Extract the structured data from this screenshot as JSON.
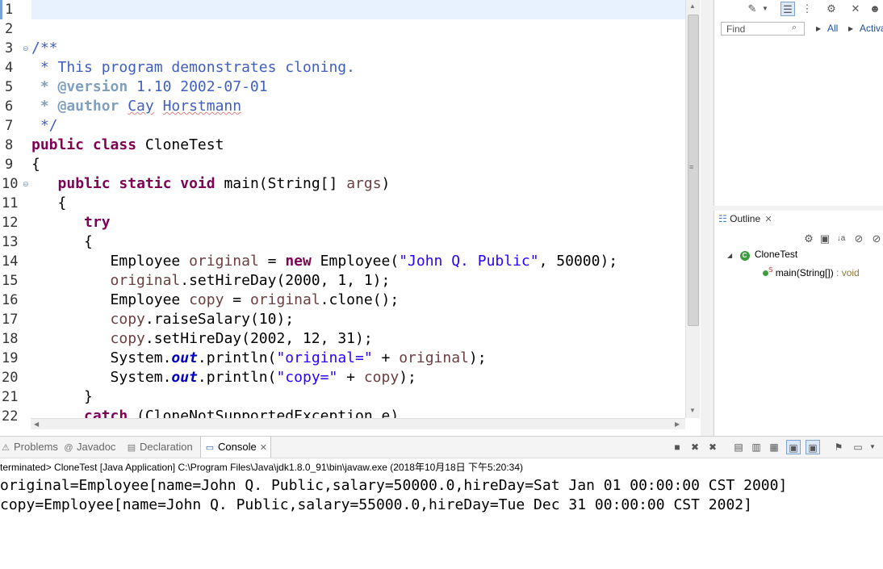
{
  "editor": {
    "line_numbers": [
      "1",
      "2",
      "3",
      "4",
      "5",
      "6",
      "7",
      "8",
      "9",
      "10",
      "11",
      "12",
      "13",
      "14",
      "15",
      "16",
      "17",
      "18",
      "19",
      "20",
      "21",
      "22"
    ],
    "javadoc": {
      "open": "/**",
      "desc": " * This program demonstrates cloning.",
      "version_tag": " * @version",
      "version_val": " 1.10 2002-07-01",
      "author_tag": " * @author",
      "author_first": "Cay",
      "author_last": "Horstmann",
      "close": " */"
    },
    "kw_public": "public",
    "kw_class": "class",
    "class_name": " CloneTest",
    "brace_open": "{",
    "kw_static": "static",
    "kw_void": "void",
    "main_sig": " main(String[] ",
    "args": "args",
    "paren_close": ")",
    "kw_try": "try",
    "kw_new": "new",
    "emp_type": "Employee ",
    "var_original": "original",
    "var_copy": "copy",
    "str_name": "\"John Q. Public\"",
    "salary_arg": ", 50000);",
    "eq": " = ",
    "emp_ctor": " Employee(",
    "sethire1": ".setHireDay(2000, 1, 1);",
    "clone_call": ".clone();",
    "raise": ".raiseSalary(10);",
    "sethire2": ".setHireDay(2002, 12, 31);",
    "system": "System.",
    "out": "out",
    "println": ".println(",
    "str_original": "\"original=\"",
    "str_copy": "\"copy=\"",
    "plus": " + ",
    "end": ");",
    "brace_close": "}",
    "kw_catch": "catch",
    "catch_rest": " (CloneNotSupportedException e)"
  },
  "right_panel": {
    "find_placeholder": "Find",
    "all_label": "All",
    "activate_label": "Activa"
  },
  "outline": {
    "tab_label": "Outline",
    "class_item": "CloneTest",
    "static_marker": "S",
    "method_item": "main(String[])",
    "method_return": " : void"
  },
  "console": {
    "tabs": [
      "Problems",
      "Javadoc",
      "Declaration",
      "Console"
    ],
    "status": "terminated> CloneTest [Java Application] C:\\Program Files\\Java\\jdk1.8.0_91\\bin\\javaw.exe (2018年10月18日 下午5:20:34)",
    "output": [
      "original=Employee[name=John Q. Public,salary=50000.0,hireDay=Sat Jan 01 00:00:00 CST 2000]",
      "copy=Employee[name=John Q. Public,salary=55000.0,hireDay=Tue Dec 31 00:00:00 CST 2002]"
    ]
  },
  "colors": {
    "keyword": "#7f0055",
    "string": "#2a00ff",
    "javadoc": "#3f5fbf",
    "javadoc_tag": "#7f9fbf",
    "local_variable": "#6a3e3e",
    "static_field": "#0000c0",
    "current_line": "#e8f2fe"
  },
  "icons": [
    "new-view-icon",
    "sync-icon",
    "hierarchy-icon",
    "filter-icon",
    "search-icon",
    "close-icon",
    "stop-icon",
    "remove-icon",
    "pin-icon",
    "minimize-icon",
    "method-icon",
    "class-icon"
  ]
}
